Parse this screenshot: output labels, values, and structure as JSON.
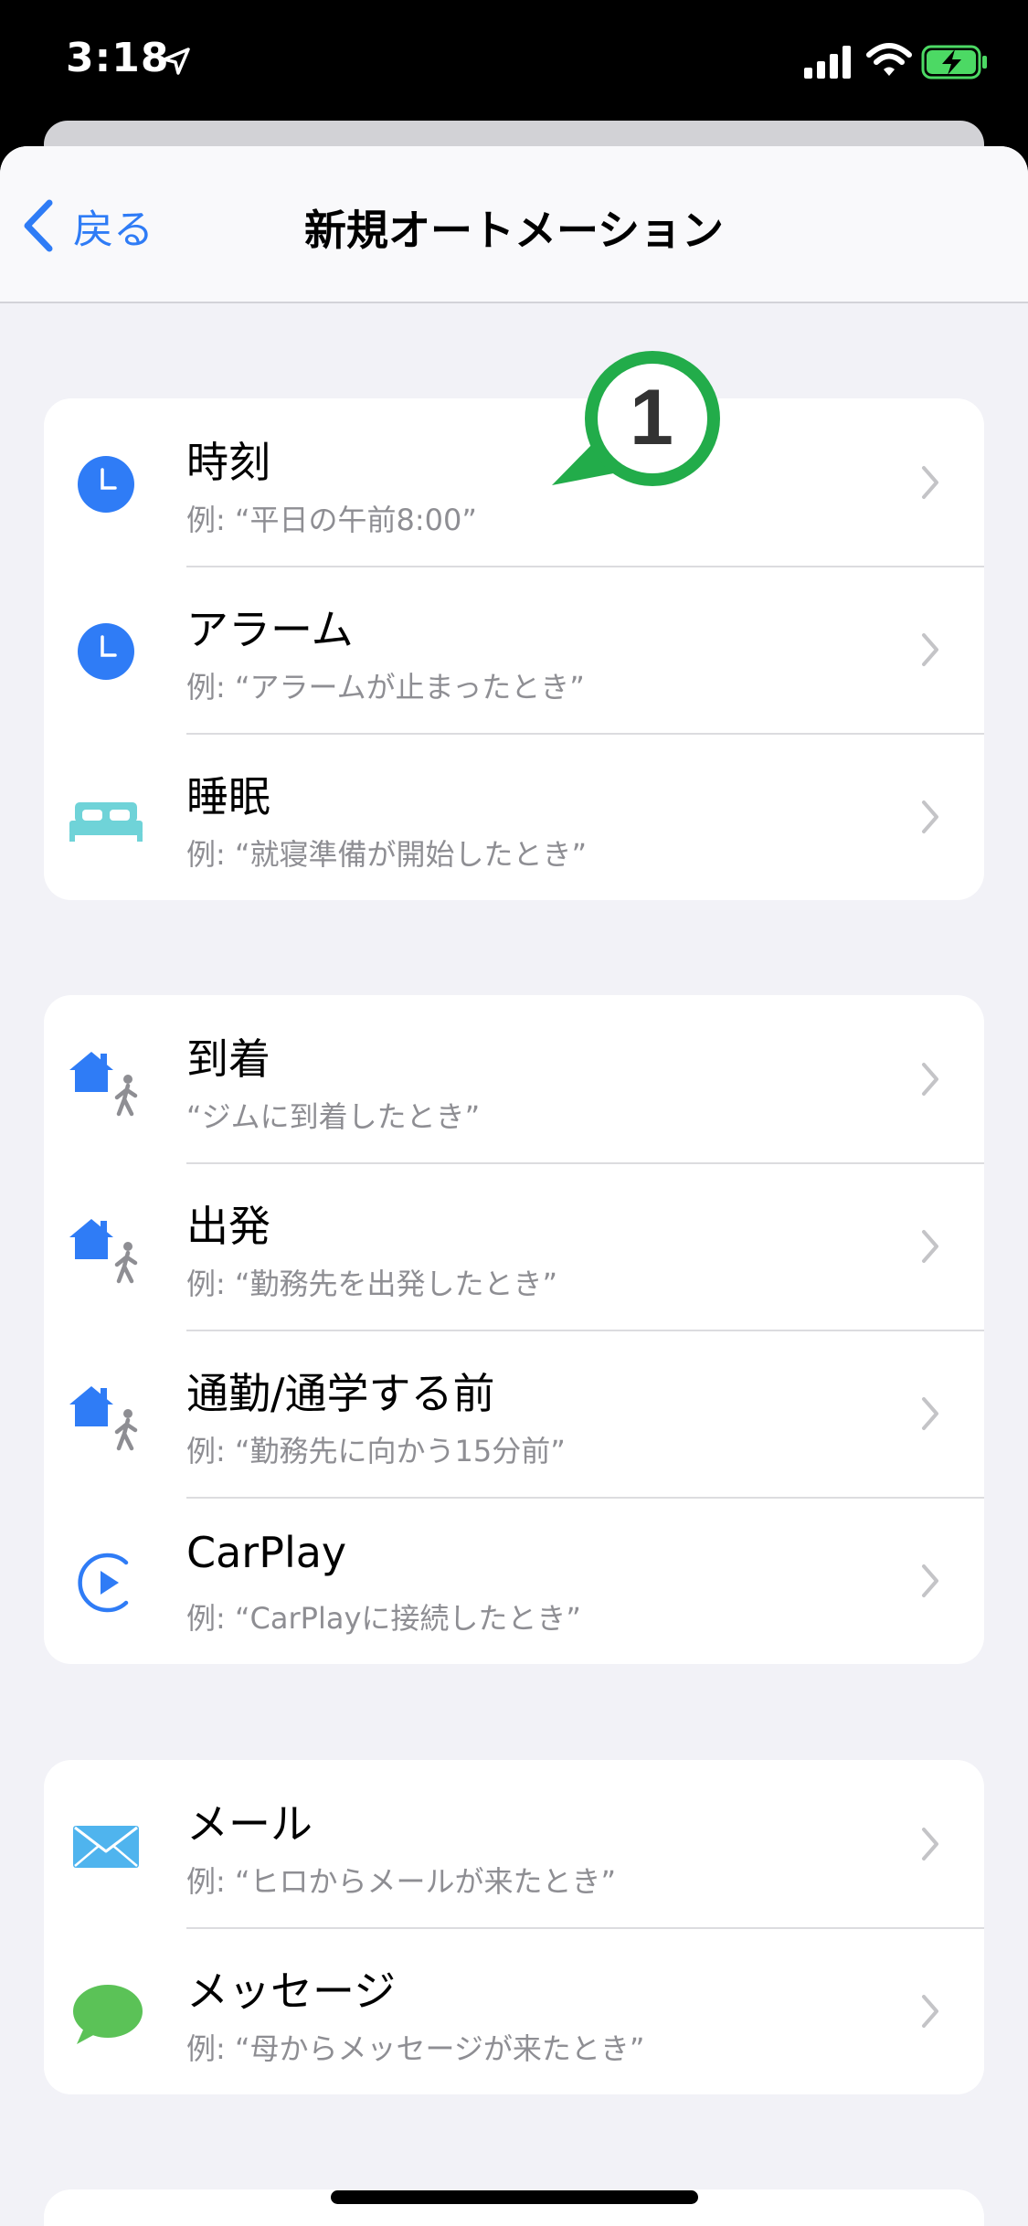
{
  "status": {
    "time": "3:18"
  },
  "nav": {
    "back_label": "戻る",
    "title": "新規オートメーション"
  },
  "annotation": {
    "number": "1",
    "color": "#22ac4a"
  },
  "colors": {
    "accent": "#2f7cf6",
    "secondary_text": "#8e8e93",
    "mail": "#4fb4ee",
    "messages": "#5bc257",
    "bed": "#6fd3d8"
  },
  "groups": [
    {
      "rows": [
        {
          "icon": "clock-icon",
          "title": "時刻",
          "subtitle": "例: “平日の午前8:00”"
        },
        {
          "icon": "alarm-clock-icon",
          "title": "アラーム",
          "subtitle": "例: “アラームが止まったとき”"
        },
        {
          "icon": "bed-icon",
          "title": "睡眠",
          "subtitle": "例: “就寝準備が開始したとき”"
        }
      ]
    },
    {
      "rows": [
        {
          "icon": "arrive-home-icon",
          "title": "到着",
          "subtitle": "“ジムに到着したとき”"
        },
        {
          "icon": "leave-home-icon",
          "title": "出発",
          "subtitle": "例: “勤務先を出発したとき”"
        },
        {
          "icon": "commute-icon",
          "title": "通勤/通学する前",
          "subtitle": "例: “勤務先に向かう15分前”"
        },
        {
          "icon": "carplay-icon",
          "title": "CarPlay",
          "subtitle": "例: “CarPlayに接続したとき”"
        }
      ]
    },
    {
      "rows": [
        {
          "icon": "mail-icon",
          "title": "メール",
          "subtitle": "例: “ヒロからメールが来たとき”"
        },
        {
          "icon": "message-bubble-icon",
          "title": "メッセージ",
          "subtitle": "例: “母からメッセージが来たとき”"
        }
      ]
    }
  ]
}
